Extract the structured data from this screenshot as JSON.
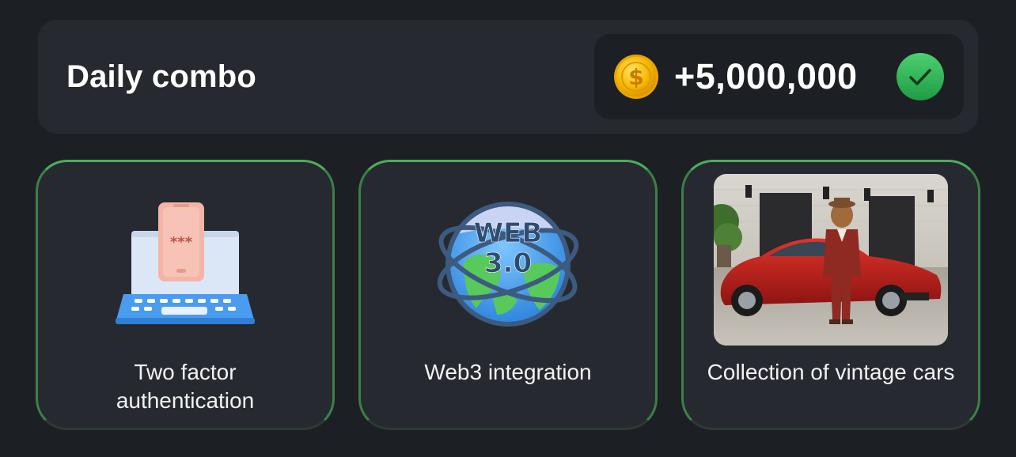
{
  "header": {
    "title": "Daily combo",
    "reward": "+5,000,000",
    "coin_icon": "gold-dollar-coin-icon",
    "check_icon": "green-check-icon"
  },
  "cards": [
    {
      "label_line1": "Two factor",
      "label_line2": "authentication",
      "icon": "laptop-phone-password-icon"
    },
    {
      "label": "Web3 integration",
      "icon": "web3-globe-icon",
      "art_text_top": "WEB",
      "art_text_bottom": "3.0"
    },
    {
      "label": "Collection of vintage cars",
      "icon": "hamster-vintage-car-photo"
    }
  ],
  "colors": {
    "background": "#1c1f24",
    "panel": "#262a30",
    "accent_green": "#4caf5a",
    "coin_gold": "#f5b800"
  }
}
